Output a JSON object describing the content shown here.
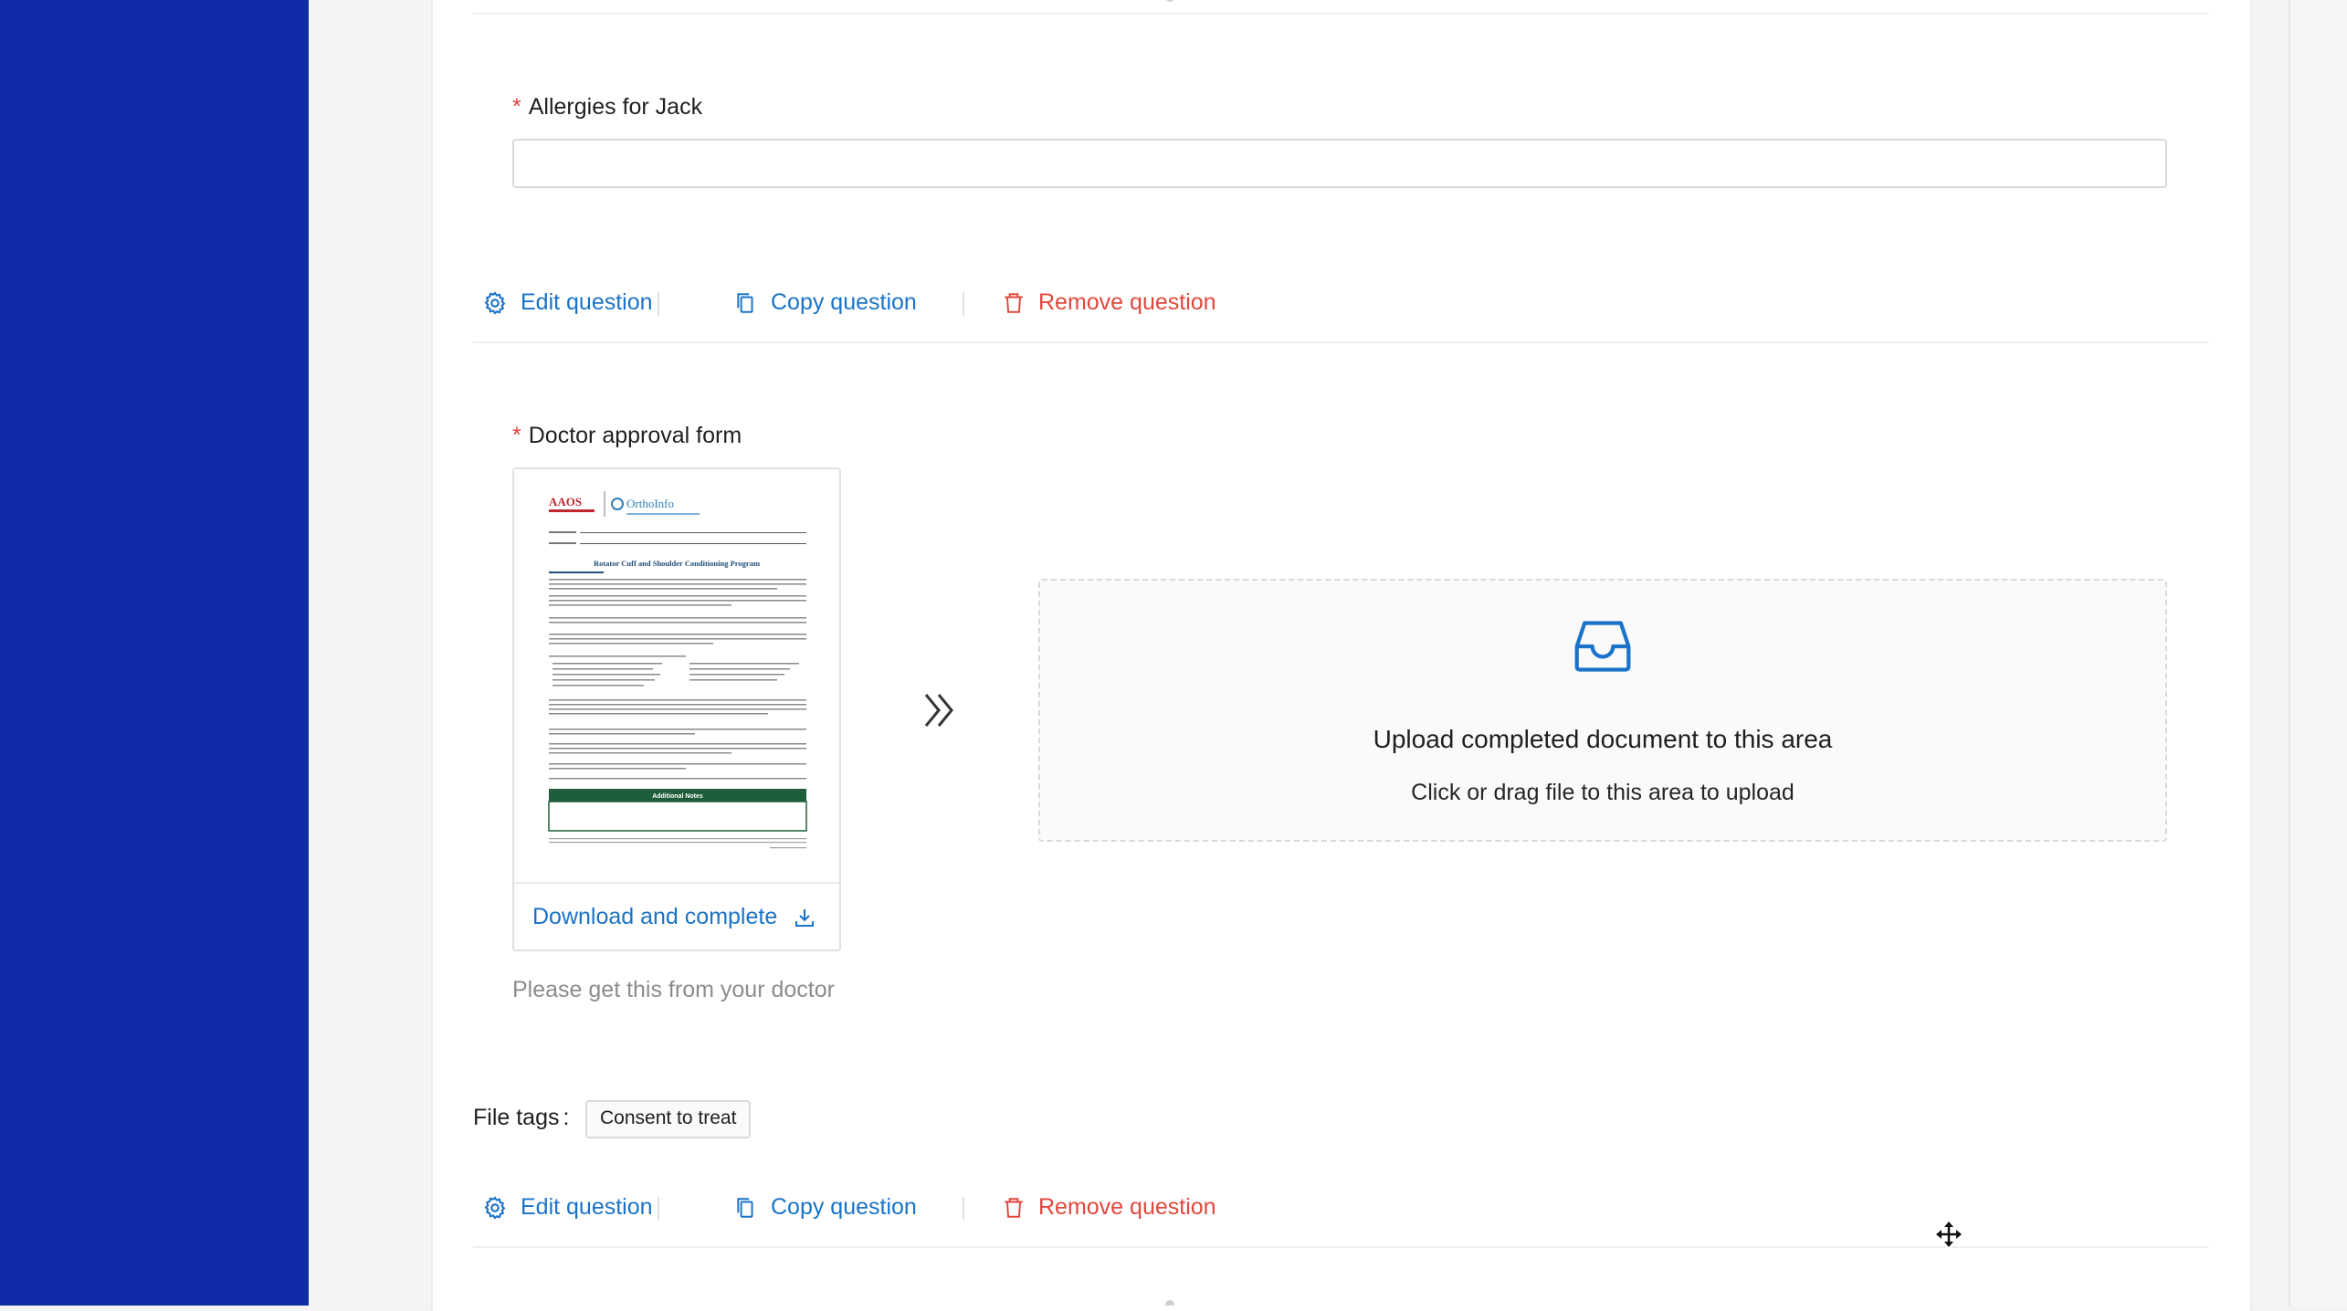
{
  "questions": [
    {
      "label": "Allergies for Jack",
      "required_mark": "*",
      "value": "",
      "actions": {
        "edit": "Edit question",
        "copy": "Copy question",
        "remove": "Remove question"
      }
    },
    {
      "label": "Doctor approval form",
      "required_mark": "*",
      "download_label": "Download and complete",
      "upload_title": "Upload completed document to this area",
      "upload_hint": "Click or drag file to this area to upload",
      "help_text": "Please get this from your doctor",
      "file_tags_label": "File tags",
      "file_tags": [
        "Consent to treat"
      ],
      "actions": {
        "edit": "Edit question",
        "copy": "Copy question",
        "remove": "Remove question"
      }
    }
  ],
  "document_thumbnail": {
    "org_logo_text": "AAOS",
    "brand": "OrthoInfo",
    "title": "Rotator Cuff and Shoulder Conditioning Program",
    "notes_header": "Additional Notes"
  },
  "colors": {
    "rail": "#0f2aa6",
    "link": "#1a73c8",
    "danger": "#e0483e",
    "required": "#e5413a"
  },
  "icons": {
    "edit": "gear-icon",
    "copy": "copy-icon",
    "remove": "trash-icon",
    "download": "download-icon",
    "upload": "inbox-icon",
    "arrow": "double-chevron-right-icon",
    "cursor": "move-cursor-icon"
  }
}
